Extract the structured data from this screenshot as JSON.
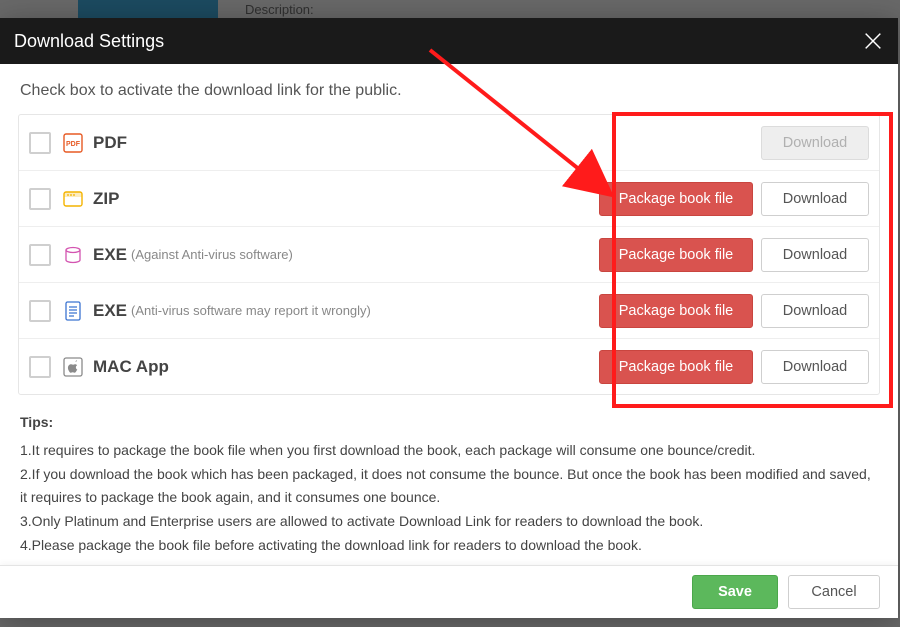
{
  "background": {
    "description_label": "Description:"
  },
  "modal": {
    "title": "Download Settings",
    "intro": "Check box to activate the download link for the public.",
    "package_label": "Package book file",
    "download_label": "Download",
    "rows": [
      {
        "id": "pdf",
        "label": "PDF",
        "note": "",
        "icon": "pdf",
        "package": false,
        "download": "disabled"
      },
      {
        "id": "zip",
        "label": "ZIP",
        "note": "",
        "icon": "zip",
        "package": true,
        "download": "enabled"
      },
      {
        "id": "exe1",
        "label": "EXE",
        "note": "(Against Anti-virus software)",
        "icon": "exe",
        "package": true,
        "download": "enabled"
      },
      {
        "id": "exe2",
        "label": "EXE",
        "note": "(Anti-virus software may report it wrongly)",
        "icon": "doc",
        "package": true,
        "download": "enabled"
      },
      {
        "id": "mac",
        "label": "MAC App",
        "note": "",
        "icon": "mac",
        "package": true,
        "download": "enabled"
      }
    ],
    "tips": {
      "heading": "Tips:",
      "items": [
        "1.It requires to package the book file when you first download the book, each package will consume one bounce/credit.",
        "2.If you download the book which has been packaged, it does not consume the bounce. But once the book has been modified and saved, it requires to package the book again, and it consumes one bounce.",
        "3.Only Platinum and Enterprise users are allowed to activate Download Link for readers to download the book.",
        "4.Please package the book file before activating the download link for readers to download the book."
      ]
    },
    "footer": {
      "save_label": "Save",
      "cancel_label": "Cancel"
    }
  },
  "colors": {
    "accent_red": "#d9534f",
    "accent_green": "#5cb85c",
    "annotation": "#ff1b1b"
  }
}
